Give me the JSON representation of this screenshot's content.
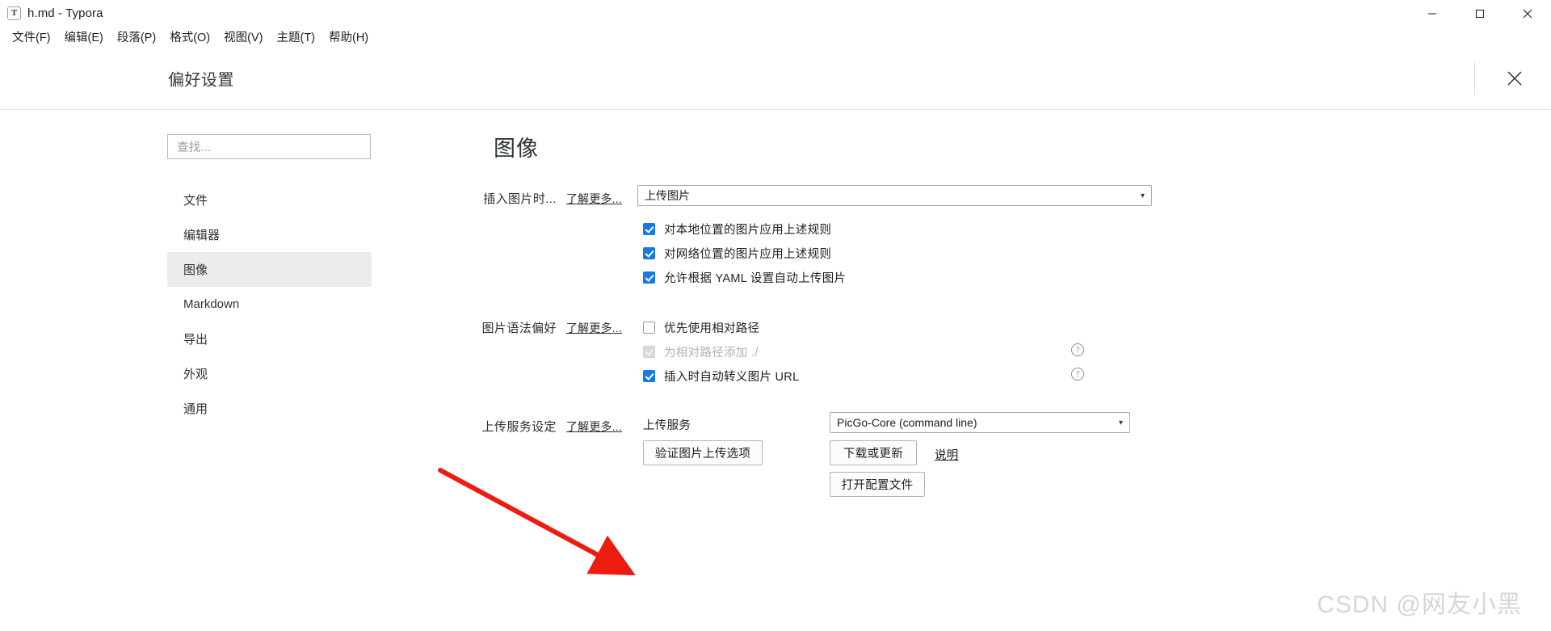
{
  "window": {
    "title": "h.md - Typora",
    "app_icon_letter": "T",
    "controls": {
      "minimize": "minimize-icon",
      "maximize": "maximize-icon",
      "close": "close-icon"
    }
  },
  "menubar": {
    "items": [
      {
        "label": "文件(F)"
      },
      {
        "label": "编辑(E)"
      },
      {
        "label": "段落(P)"
      },
      {
        "label": "格式(O)"
      },
      {
        "label": "视图(V)"
      },
      {
        "label": "主题(T)"
      },
      {
        "label": "帮助(H)"
      }
    ]
  },
  "preferences": {
    "header_title": "偏好设置",
    "close_label": "✕"
  },
  "sidebar": {
    "search": {
      "placeholder": "查找...",
      "value": ""
    },
    "items": [
      {
        "label": "文件",
        "active": false
      },
      {
        "label": "编辑器",
        "active": false
      },
      {
        "label": "图像",
        "active": true
      },
      {
        "label": "Markdown",
        "active": false
      },
      {
        "label": "导出",
        "active": false
      },
      {
        "label": "外观",
        "active": false
      },
      {
        "label": "通用",
        "active": false
      }
    ]
  },
  "main": {
    "title": "图像",
    "sections": {
      "insert": {
        "label": "插入图片时...",
        "learn_more": "了解更多...",
        "dropdown_value": "上传图片",
        "checkboxes": [
          {
            "label": "对本地位置的图片应用上述规则",
            "state": "checked"
          },
          {
            "label": "对网络位置的图片应用上述规则",
            "state": "checked"
          },
          {
            "label": "允许根据 YAML 设置自动上传图片",
            "state": "checked"
          }
        ]
      },
      "syntax": {
        "label": "图片语法偏好",
        "learn_more": "了解更多...",
        "checkboxes": [
          {
            "label": "优先使用相对路径",
            "state": "unchecked"
          },
          {
            "label": "为相对路径添加 ./",
            "state": "disabled"
          },
          {
            "label": "插入时自动转义图片 URL",
            "state": "checked"
          }
        ],
        "help_icons": [
          "help-icon",
          "help-icon"
        ]
      },
      "upload": {
        "label": "上传服务设定",
        "learn_more": "了解更多...",
        "service_label": "上传服务",
        "service_value": "PicGo-Core (command line)",
        "verify_button": "验证图片上传选项",
        "download_button": "下载或更新",
        "doc_link": "说明",
        "open_config_button": "打开配置文件"
      }
    }
  },
  "annotation": {
    "arrow_color": "#ee1b11"
  },
  "watermark": {
    "text": "CSDN @网友小黑"
  }
}
